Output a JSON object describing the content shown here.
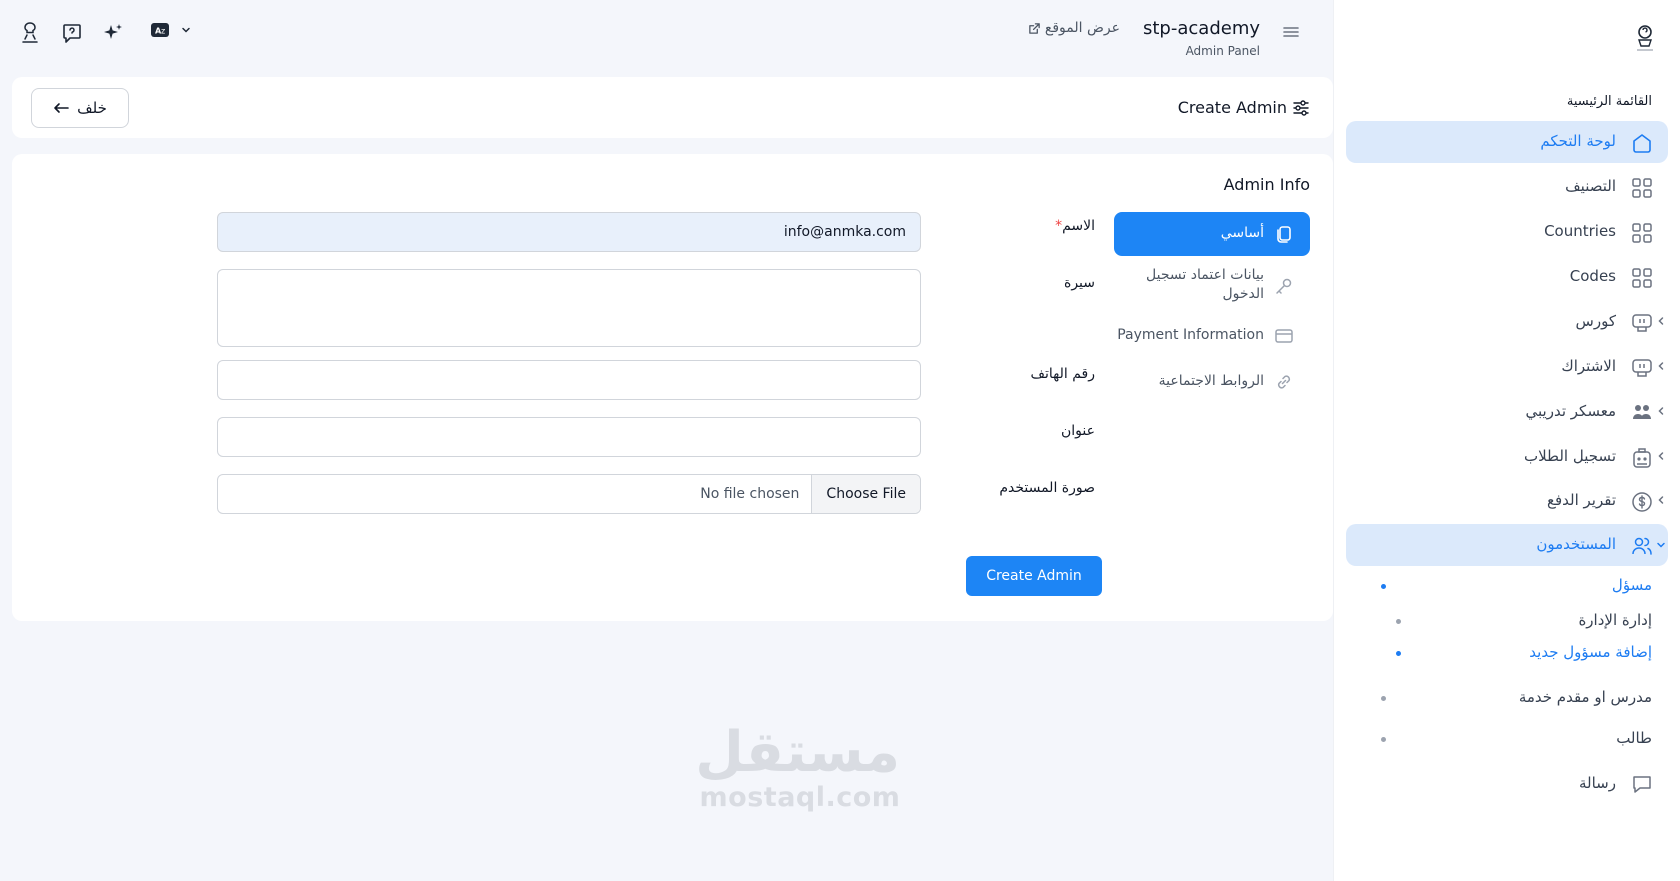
{
  "app": {
    "title": "stp-academy",
    "subtitle": "Admin Panel",
    "view_site": "عرض الموقع"
  },
  "page": {
    "title": "Create Admin",
    "back_label": "خلف"
  },
  "sidebar": {
    "section_title": "القائمة الرئيسية",
    "items": [
      {
        "label": "لوحة التحكم",
        "icon": "home-icon",
        "active": true
      },
      {
        "label": "التصنيف",
        "icon": "grid-icon"
      },
      {
        "label": "Countries",
        "icon": "grid-icon"
      },
      {
        "label": "Codes",
        "icon": "grid-icon"
      },
      {
        "label": "كورس",
        "icon": "course-icon",
        "has_submenu": true
      },
      {
        "label": "الاشتراك",
        "icon": "subscription-icon",
        "has_submenu": true
      },
      {
        "label": "معسكر تدريبي",
        "icon": "group-icon",
        "has_submenu": true
      },
      {
        "label": "تسجيل الطلاب",
        "icon": "students-icon",
        "has_submenu": true
      },
      {
        "label": "تقرير الدفع",
        "icon": "dollar-icon",
        "has_submenu": true
      },
      {
        "label": "المستخدمون",
        "icon": "users-icon",
        "has_submenu": true,
        "expanded": true
      },
      {
        "label": "رسالة",
        "icon": "message-icon"
      }
    ],
    "users_sub": {
      "admin": "مسؤل",
      "manage": "إدارة الإدارة",
      "add_new": "إضافة مسؤول جديد",
      "teacher": "مدرس او مقدم خدمة",
      "student": "طالب"
    }
  },
  "form": {
    "section_title": "Admin Info",
    "tabs": [
      {
        "label": "أساسي",
        "icon": "copy-icon",
        "active": true
      },
      {
        "label": "بيانات اعتماد تسجيل الدخول",
        "icon": "key-icon"
      },
      {
        "label": "Payment Information",
        "icon": "card-icon"
      },
      {
        "label": "الروابط الاجتماعية",
        "icon": "link-icon"
      }
    ],
    "fields": {
      "name_label": "الاسم",
      "name_required": "*",
      "name_value": "info@anmka.com",
      "bio_label": "سيرة",
      "phone_label": "رقم الهاتف",
      "address_label": "عنوان",
      "photo_label": "صورة المستخدم",
      "file_button": "Choose File",
      "file_status": "No file chosen"
    },
    "submit_label": "Create Admin"
  },
  "watermark": {
    "arabic": "مستقل",
    "latin": "mostaql.com"
  },
  "colors": {
    "accent": "#1d85f5",
    "active_bg": "#dbe9fb",
    "page_bg": "#f4f6fb"
  }
}
